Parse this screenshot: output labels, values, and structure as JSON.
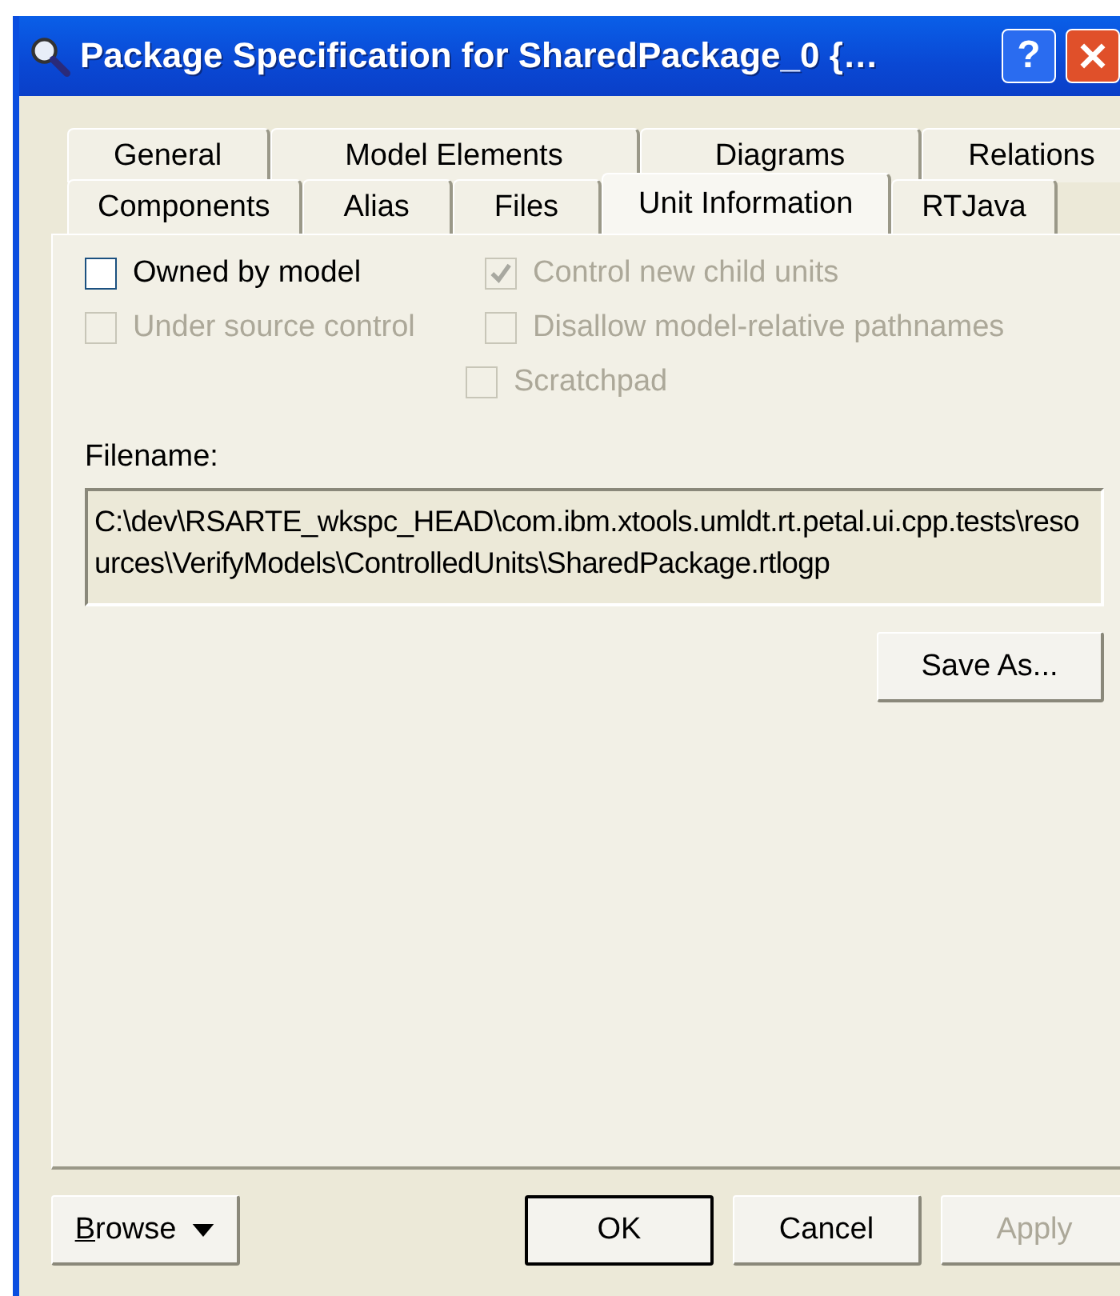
{
  "window": {
    "title": "Package Specification for SharedPackage_0 {…",
    "help_button": "?"
  },
  "tab_rows": [
    {
      "tabs": [
        {
          "label": "General",
          "selected": false
        },
        {
          "label": "Model Elements",
          "selected": false
        },
        {
          "label": "Diagrams",
          "selected": false
        },
        {
          "label": "Relations",
          "selected": false
        }
      ]
    },
    {
      "tabs": [
        {
          "label": "Components",
          "selected": false
        },
        {
          "label": "Alias",
          "selected": false
        },
        {
          "label": "Files",
          "selected": false
        },
        {
          "label": "Unit Information",
          "selected": true
        },
        {
          "label": "RTJava",
          "selected": false
        }
      ]
    }
  ],
  "option_columns": [
    {
      "options": [
        {
          "label": "Owned by model",
          "checked": false,
          "disabled": false
        },
        {
          "label": "Under source control",
          "checked": false,
          "disabled": true
        }
      ]
    },
    {
      "options": [
        {
          "label": "Control new child units",
          "checked": true,
          "disabled": true
        },
        {
          "label": "Disallow model-relative pathnames",
          "checked": false,
          "disabled": true
        },
        {
          "label": "Scratchpad",
          "checked": false,
          "disabled": true
        }
      ]
    }
  ],
  "filename": {
    "label": "Filename:",
    "value": "C:\\dev\\RSARTE_wkspc_HEAD\\com.ibm.xtools.umldt.rt.petal.ui.cpp.tests\\resources\\VerifyModels\\ControlledUnits\\SharedPackage.rtlogp"
  },
  "save_button": {
    "label": "Save As..."
  },
  "footer": {
    "browse": {
      "label": "Browse",
      "disabled": false
    },
    "buttons": [
      {
        "label": "OK",
        "disabled": false,
        "default": true
      },
      {
        "label": "Cancel",
        "disabled": false,
        "default": false
      },
      {
        "label": "Apply",
        "disabled": true,
        "default": false
      }
    ]
  }
}
